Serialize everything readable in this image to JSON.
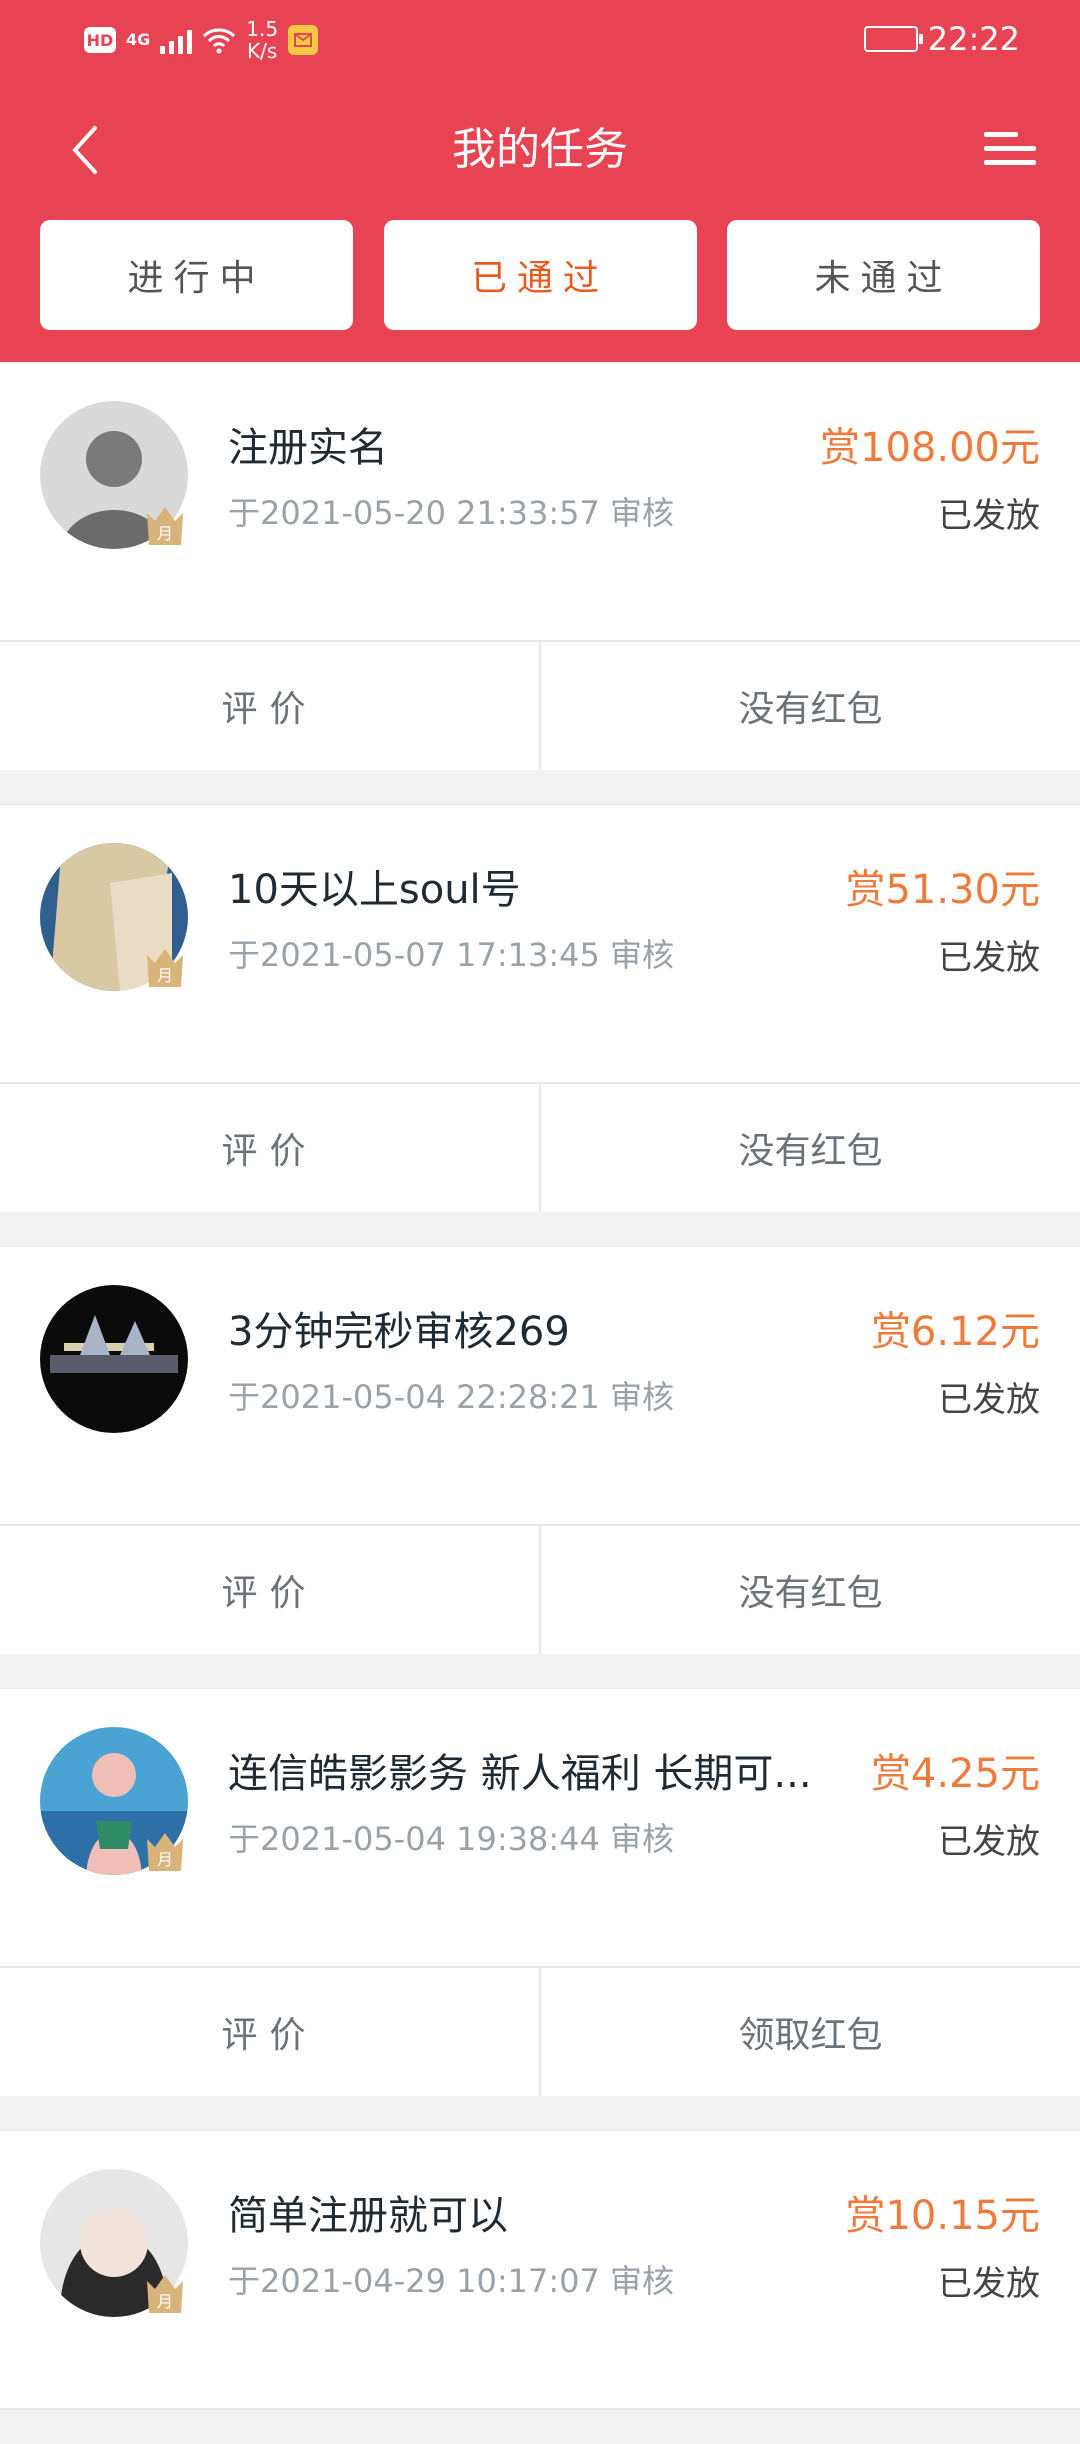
{
  "status_bar": {
    "hd": "HD",
    "net": "4G",
    "speed_value": "1.5",
    "speed_unit": "K/s",
    "time": "22:22"
  },
  "header": {
    "title": "我的任务"
  },
  "tabs": [
    {
      "label": "进行中",
      "active": false
    },
    {
      "label": "已通过",
      "active": true
    },
    {
      "label": "未通过",
      "active": false
    }
  ],
  "tasks": [
    {
      "title": "注册实名",
      "time": "于2021-05-20 21:33:57 审核",
      "reward": "赏108.00元",
      "status": "已发放",
      "action_left": "评价",
      "action_right": "没有红包",
      "avatar_colors": [
        "#d9d9d9",
        "#6b6b6b"
      ]
    },
    {
      "title": "10天以上soul号",
      "time": "于2021-05-07 17:13:45 审核",
      "reward": "赏51.30元",
      "status": "已发放",
      "action_left": "评价",
      "action_right": "没有红包",
      "avatar_colors": [
        "#d9c8a4",
        "#2e5f8f"
      ]
    },
    {
      "title": "3分钟完秒审核269",
      "time": "于2021-05-04 22:28:21 审核",
      "reward": "赏6.12元",
      "status": "已发放",
      "action_left": "评价",
      "action_right": "没有红包",
      "avatar_colors": [
        "#0b0b0b",
        "#d7d1b0"
      ]
    },
    {
      "title": "连信皓影影务 新人福利 长期可...",
      "time": "于2021-05-04 19:38:44 审核",
      "reward": "赏4.25元",
      "status": "已发放",
      "action_left": "评价",
      "action_right": "领取红包",
      "avatar_colors": [
        "#4aa3d3",
        "#f0c0b8"
      ]
    },
    {
      "title": "简单注册就可以",
      "time": "于2021-04-29 10:17:07 审核",
      "reward": "赏10.15元",
      "status": "已发放",
      "action_left": "评价",
      "action_right": "",
      "avatar_colors": [
        "#e6e6e6",
        "#2a2a2a"
      ]
    }
  ],
  "colors": {
    "header_red": "#e84352",
    "reward_orange": "#ee7a3c",
    "active_tab_orange": "#e85a1f"
  }
}
